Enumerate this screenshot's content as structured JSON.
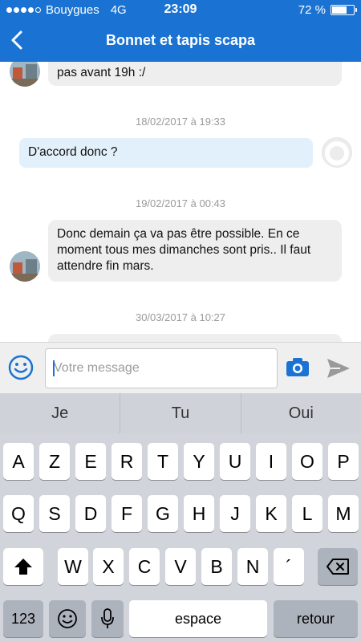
{
  "status_bar": {
    "carrier": "Bouygues",
    "network": "4G",
    "time": "23:09",
    "battery": "72 %",
    "battery_level": 0.72,
    "signal_bars": 4
  },
  "nav": {
    "title": "Bonnet et tapis scapa",
    "back_icon": "chevron-left-icon"
  },
  "messages": [
    {
      "text": "pas avant 19h :/"
    },
    {
      "stamp": "18/02/2017 à 19:33",
      "text": "D'accord donc ?"
    },
    {
      "stamp": "19/02/2017 à 00:43",
      "text": "Donc demain ça va pas être possible. En ce moment tous mes dimanches sont pris.. Il faut attendre fin mars."
    },
    {
      "stamp": "30/03/2017 à 10:27"
    }
  ],
  "composer": {
    "placeholder": "Votre message",
    "emoji_icon": "smiley-icon",
    "camera_icon": "camera-icon",
    "send_icon": "send-icon"
  },
  "keyboard": {
    "suggestions": [
      "Je",
      "Tu",
      "Oui"
    ],
    "row1": [
      "A",
      "Z",
      "E",
      "R",
      "T",
      "Y",
      "U",
      "I",
      "O",
      "P"
    ],
    "row2": [
      "Q",
      "S",
      "D",
      "F",
      "G",
      "H",
      "J",
      "K",
      "L",
      "M"
    ],
    "row3": [
      "W",
      "X",
      "C",
      "V",
      "B",
      "N",
      "´"
    ],
    "numbers_key": "123",
    "space_key": "espace",
    "return_key": "retour"
  },
  "colors": {
    "header": "#1a73d2",
    "outgoing_bubble": "#e2f0fb",
    "incoming_bubble": "#eeeeee"
  }
}
